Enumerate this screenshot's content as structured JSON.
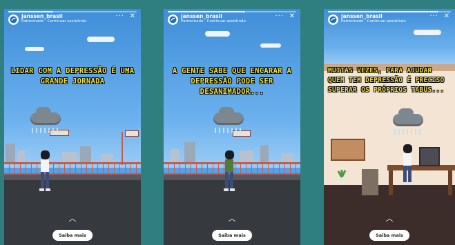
{
  "stories": [
    {
      "account": "janssen_brasil",
      "subtitle": "Patrocinado · Continuar assistindo",
      "more": "···",
      "close": "✕",
      "caption": "Lidar com a depressão é uma grande jornada",
      "cta": "Saiba mais",
      "progress": 0.35
    },
    {
      "account": "janssen_brasil",
      "subtitle": "Patrocinado · Continuar assistindo",
      "more": "···",
      "close": "✕",
      "caption": "A gente sabe que encarar a depressão pode ser desanimador...",
      "cta": "Saiba mais",
      "progress": 0.6
    },
    {
      "account": "janssen_brasil",
      "subtitle": "Patrocinado · Continuar assistindo",
      "more": "···",
      "close": "✕",
      "caption": "Muitas vezes, para ajudar quem tem depressão é preciso superar os próprios tabus...",
      "cta": "Saiba mais",
      "progress": 0.9
    }
  ],
  "icons": {
    "chevron": "chevron-up-icon",
    "logo": "janssen-logo-icon"
  },
  "colors": {
    "background": "#2f7f80",
    "caption": "#f1e24a",
    "sky": "#5aa0e6",
    "rail": "#c45d4c"
  }
}
